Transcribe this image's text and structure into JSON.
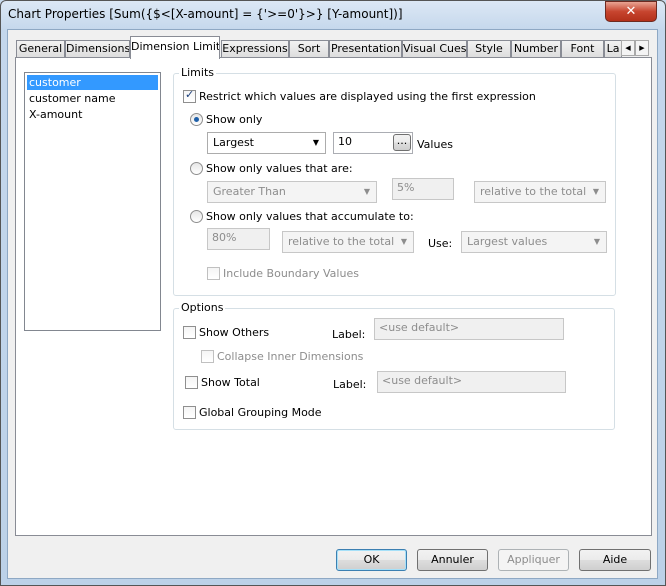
{
  "window": {
    "title": "Chart Properties [Sum({$<[X-amount] = {'>=0'}>} [Y-amount])]",
    "close_icon": "close-x"
  },
  "tabs": [
    "General",
    "Dimensions",
    "Dimension Limits",
    "Expressions",
    "Sort",
    "Presentation",
    "Visual Cues",
    "Style",
    "Number",
    "Font",
    "La"
  ],
  "active_tab": "Dimension Limits",
  "dimensions": {
    "items": [
      "customer",
      "customer name",
      "X-amount"
    ],
    "selected": "customer"
  },
  "limits": {
    "group_label": "Limits",
    "restrict_label": "Restrict which values are displayed using the first expression",
    "restrict_checked": true,
    "show_only_label": "Show only",
    "show_only_selected": true,
    "show_only_combo": "Largest",
    "show_only_value": "10",
    "ellipsis": "...",
    "values_label": "Values",
    "values_are_label": "Show only values that are:",
    "values_are_combo": "Greater Than",
    "values_are_value": "5%",
    "values_are_relative": "relative to the total",
    "accumulate_label": "Show only values that accumulate to:",
    "accumulate_value": "80%",
    "accumulate_relative": "relative to the total",
    "use_label": "Use:",
    "use_combo": "Largest values",
    "boundary_label": "Include Boundary Values",
    "boundary_checked": false
  },
  "options": {
    "group_label": "Options",
    "show_others_label": "Show Others",
    "show_others_checked": false,
    "others_label_caption": "Label:",
    "others_label_value": "<use default>",
    "collapse_label": "Collapse Inner Dimensions",
    "show_total_label": "Show Total",
    "show_total_checked": false,
    "total_label_caption": "Label:",
    "total_label_value": "<use default>",
    "global_grouping_label": "Global Grouping Mode",
    "global_grouping_checked": false
  },
  "buttons": {
    "ok": "OK",
    "cancel": "Annuler",
    "apply": "Appliquer",
    "help": "Aide"
  }
}
